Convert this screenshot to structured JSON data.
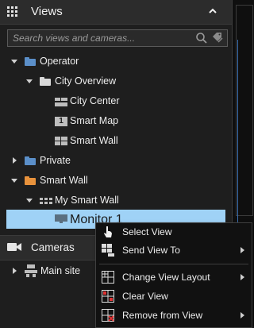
{
  "views_panel": {
    "title": "Views",
    "search_placeholder": "Search views and cameras...",
    "tree": {
      "operator": "Operator",
      "city_overview": "City Overview",
      "city_center": "City Center",
      "smart_map": "Smart Map",
      "smart_map_badge": "1",
      "smart_wall_view": "Smart Wall",
      "private": "Private",
      "smart_wall_group": "Smart Wall",
      "my_smart_wall": "My Smart Wall",
      "monitor": "Monitor 1"
    }
  },
  "cameras_panel": {
    "title": "Cameras",
    "tree": {
      "main_site": "Main site"
    }
  },
  "context_menu": {
    "select_view": "Select View",
    "send_view_to": "Send View To",
    "change_view_layout": "Change View Layout",
    "clear_view": "Clear View",
    "remove_from_view": "Remove from View"
  },
  "colors": {
    "background": "#1e1e1e",
    "header": "#2c2c2c",
    "selection": "#9fd2f6",
    "folder_blue": "#5b8fc9",
    "folder_orange": "#e8923c",
    "accent_blue": "#3a6fb0"
  }
}
